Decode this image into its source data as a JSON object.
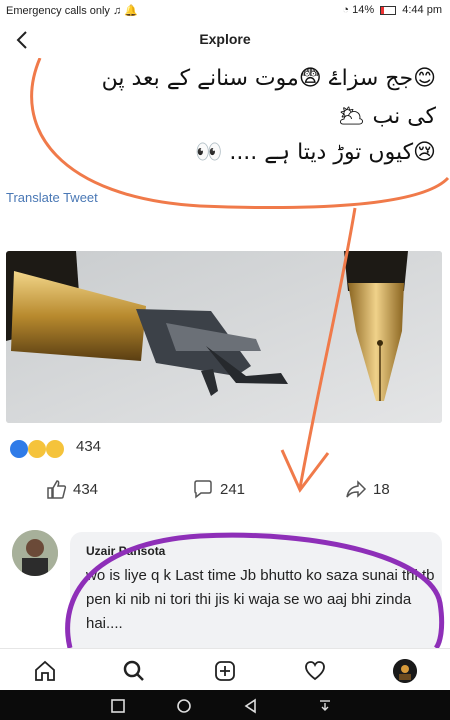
{
  "status_bar": {
    "left_text": "Emergency calls only",
    "battery": "14%",
    "time": "4:44 pm"
  },
  "app_bar": {
    "title": "Explore"
  },
  "post": {
    "urdu_line1": "😊جج سزاۓ 😨موت سنانے کے بعد پن",
    "urdu_line2": "کی نب 🌥",
    "urdu_line3": "😢کیوں توڑ دیتا ہے .... 👀",
    "translate_label": "Translate Tweet",
    "reaction_count": "434",
    "like_count": "434",
    "comment_count": "241",
    "share_count": "18"
  },
  "comment": {
    "author": "Uzair Pansota",
    "text": "wo is liye q k Last time Jb bhutto ko saza sunai thi tb pen ki nib ni tori thi jis ki waja se wo aaj bhi zinda hai...."
  },
  "colors": {
    "annotation_orange": "#f07a4a",
    "annotation_purple": "#8e2fb8",
    "like_blue": "#2f7be8",
    "translate_blue": "#4a78b5"
  },
  "icons": {
    "nav": [
      "home-icon",
      "search-icon",
      "add-post-icon",
      "heart-icon",
      "profile-avatar"
    ],
    "system": [
      "recent-apps-icon",
      "home-circle-icon",
      "back-triangle-icon",
      "notification-pull-icon"
    ]
  }
}
